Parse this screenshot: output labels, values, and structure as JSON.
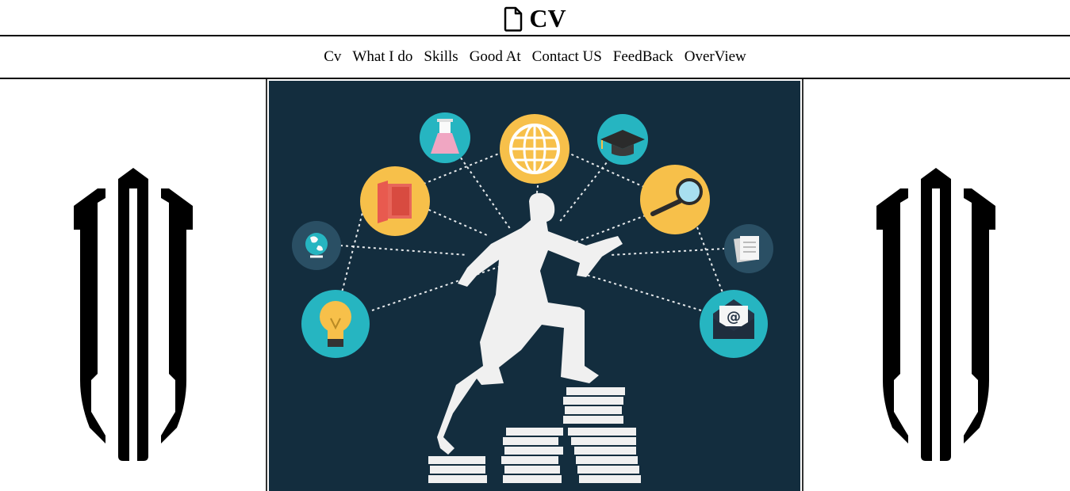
{
  "header": {
    "title": "CV",
    "icon": "file-icon"
  },
  "nav": {
    "items": [
      {
        "label": "Cv"
      },
      {
        "label": "What I do"
      },
      {
        "label": "Skills"
      },
      {
        "label": "Good At"
      },
      {
        "label": "Contact US"
      },
      {
        "label": "FeedBack"
      },
      {
        "label": "OverView"
      }
    ]
  },
  "hero": {
    "icons": [
      "flask-icon",
      "globe-icon",
      "graduation-cap-icon",
      "book-icon",
      "magnifier-icon",
      "earth-icon",
      "documents-icon",
      "lightbulb-icon",
      "email-icon"
    ],
    "colors": {
      "background": "#132d3e",
      "teal": "#26b5c1",
      "yellow": "#f7c04a",
      "figure": "#f0f0f0"
    }
  },
  "logos": {
    "left": "trident-logo",
    "right": "trident-logo"
  }
}
